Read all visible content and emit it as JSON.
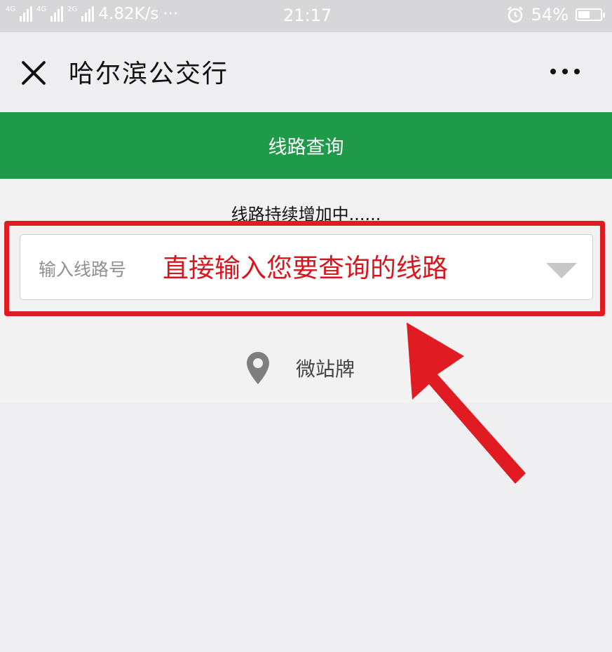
{
  "status_bar": {
    "net_1": "4G",
    "net_2": "4G",
    "net_3": "2G",
    "speed": "4.82K/s",
    "ellipsis": "···",
    "time": "21:17",
    "battery": "54%",
    "battery_level": 0.54
  },
  "header": {
    "title": "哈尔滨公交行",
    "close_icon": "close-icon",
    "more_icon": "more-icon"
  },
  "tab": {
    "label": "线路查询"
  },
  "notice": "线路持续增加中......",
  "line_input": {
    "placeholder": "输入线路号",
    "value": ""
  },
  "annotation": "直接输入您要查询的线路",
  "station_link": {
    "label": "微站牌",
    "icon": "location-pin-icon"
  },
  "colors": {
    "accent": "#1f9a4a",
    "annotation_red": "#e11b22"
  }
}
